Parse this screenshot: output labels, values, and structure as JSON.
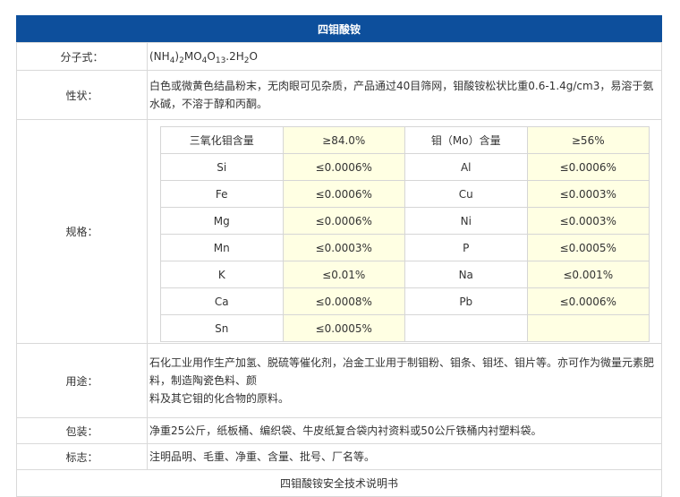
{
  "header": {
    "title": "四钼酸铵"
  },
  "rows": {
    "formula": {
      "label": "分子式：",
      "parts": [
        "(NH",
        "4",
        ")",
        "2",
        "MO",
        "4",
        "O",
        "13",
        ".2H",
        "2",
        "O"
      ]
    },
    "properties": {
      "label": "性状：",
      "text": "白色或微黄色结晶粉末，无肉眼可见杂质，产品通过40目筛网，钼酸铵松状比重0.6-1.4g/cm3，易溶于氨水碱，不溶于醇和丙酮。"
    },
    "spec": {
      "label": "规格：",
      "table": [
        [
          "三氧化钼含量",
          "≥84.0%",
          "钼（Mo）含量",
          "≥56%"
        ],
        [
          "Si",
          "≤0.0006%",
          "Al",
          "≤0.0006%"
        ],
        [
          "Fe",
          "≤0.0006%",
          "Cu",
          "≤0.0003%"
        ],
        [
          "Mg",
          "≤0.0006%",
          "Ni",
          "≤0.0003%"
        ],
        [
          "Mn",
          "≤0.0003%",
          "P",
          "≤0.0005%"
        ],
        [
          "K",
          "≤0.01%",
          "Na",
          "≤0.001%"
        ],
        [
          "Ca",
          "≤0.0008%",
          "Pb",
          "≤0.0006%"
        ],
        [
          "Sn",
          "≤0.0005%",
          "",
          ""
        ]
      ]
    },
    "usage": {
      "label": "用途：",
      "line1": "石化工业用作生产加氢、脱硫等催化剂，冶金工业用于制钼粉、钼条、钼坯、钼片等。亦可作为微量元素肥料，制造陶瓷色料、颜",
      "line2": "料及其它钼的化合物的原料。"
    },
    "packaging": {
      "label": "包装：",
      "text": "净重25公斤，纸板桶、编织袋、牛皮纸复合袋内衬资料或50公斤铁桶内衬塑料袋。"
    },
    "marking": {
      "label": "标志：",
      "text": "注明品明、毛重、净重、含量、批号、厂名等。"
    }
  },
  "footer": {
    "text": "四钼酸铵安全技术说明书"
  }
}
